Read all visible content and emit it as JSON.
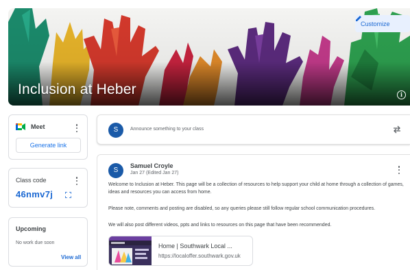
{
  "banner": {
    "class_name": "Inclusion at Heber",
    "customize_label": "Customize",
    "colors": [
      "#1b8a6b",
      "#e6b32a",
      "#d3392c",
      "#5b2b7d",
      "#2d9f4f",
      "#e08a2a"
    ]
  },
  "meet": {
    "label": "Meet",
    "generate_label": "Generate link"
  },
  "class_code": {
    "label": "Class code",
    "value": "46nmv7j"
  },
  "upcoming": {
    "title": "Upcoming",
    "empty_text": "No work due soon",
    "view_all": "View all"
  },
  "announce": {
    "avatar_initial": "S",
    "placeholder": "Announce something to your class"
  },
  "post": {
    "avatar_initial": "S",
    "author": "Samuel Croyle",
    "date": "Jan 27 (Edited Jan 27)",
    "paragraphs": [
      "Welcome to Inclusion at Heber.  This page will be a collection of resources to help support your child at home through a collection of games, ideas and resources you can access from home.",
      "Please note, comments and posting are disabled, so any queries please still follow regular school communication procedures.",
      "We will also post different videos, ppts and links to resources on this page that have been recommended."
    ],
    "link": {
      "title": "Home | Southwark Local ...",
      "url": "https://localoffer.southwark.gov.uk"
    }
  }
}
